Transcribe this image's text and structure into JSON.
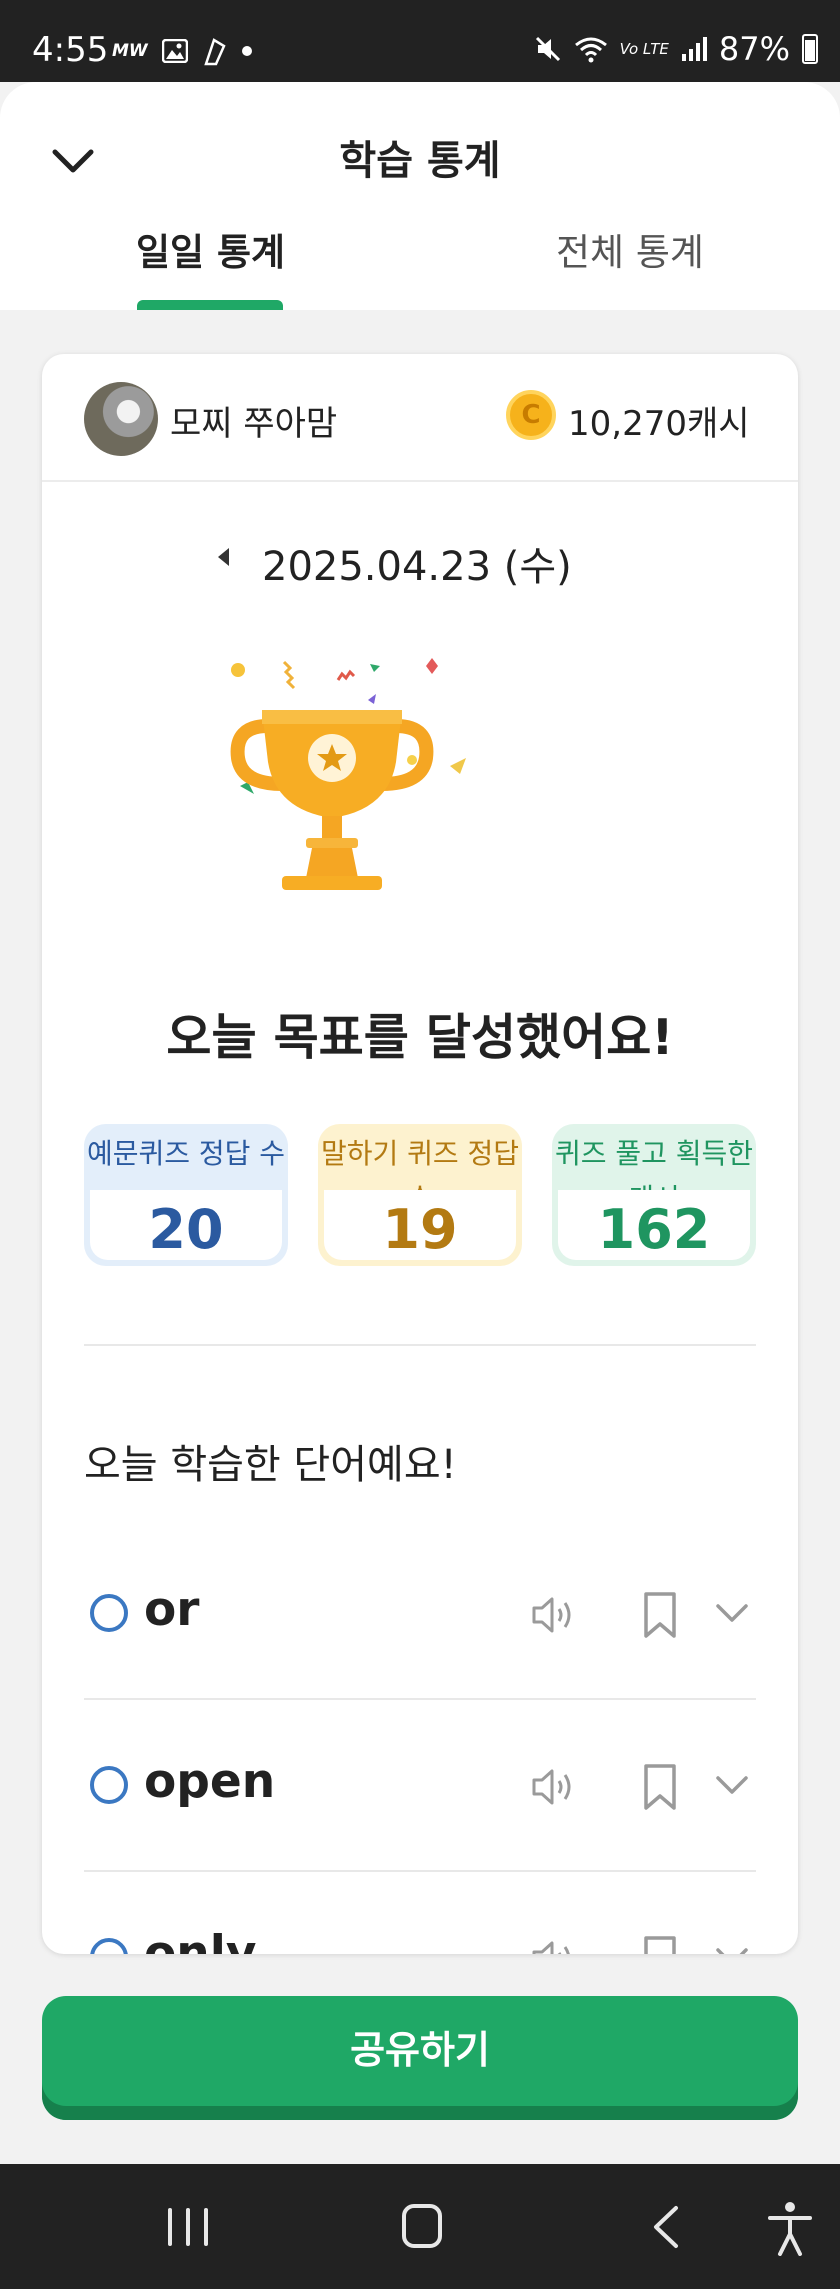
{
  "status_bar": {
    "time": "4:55",
    "carrier_icon": "MW",
    "network": "Vo LTE",
    "battery": "87%"
  },
  "header": {
    "title": "학습 통계",
    "tabs": [
      {
        "label": "일일 통계",
        "selected": true
      },
      {
        "label": "전체 통계",
        "selected": false
      }
    ]
  },
  "profile": {
    "name": "모찌 쭈아맘",
    "coin_symbol": "C",
    "cash": "10,270캐시"
  },
  "date": "2025.04.23 (수)",
  "goal_message": "오늘 목표를 달성했어요!",
  "stats": [
    {
      "label": "예문퀴즈 정답 수",
      "value": "20"
    },
    {
      "label": "말하기 퀴즈 정답 수",
      "value": "19"
    },
    {
      "label": "퀴즈 풀고 획득한 캐시",
      "value": "162"
    }
  ],
  "words_section": {
    "title": "오늘 학습한 단어예요!",
    "words": [
      "or",
      "open",
      "only"
    ]
  },
  "share_button": "공유하기",
  "colors": {
    "accent": "#1fa866",
    "blue": "#2b5aa0",
    "gold": "#b37a12",
    "green": "#1f9560"
  }
}
